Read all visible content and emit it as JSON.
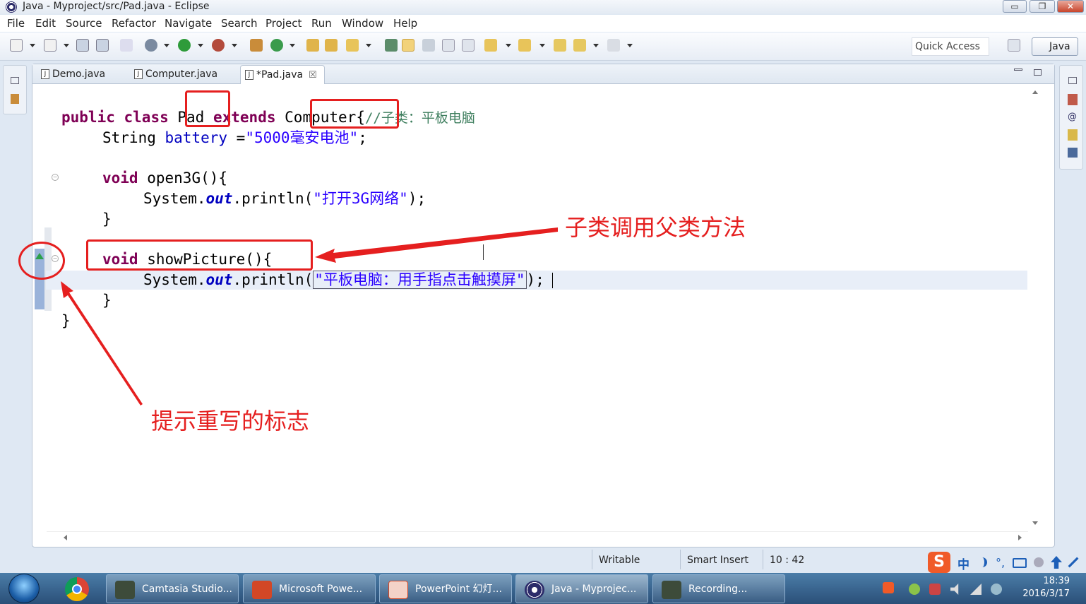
{
  "window": {
    "title": "Java - Myproject/src/Pad.java - Eclipse",
    "buttons": {
      "minimize": "▭",
      "restore": "❐",
      "close": "✕"
    }
  },
  "menu": [
    "File",
    "Edit",
    "Source",
    "Refactor",
    "Navigate",
    "Search",
    "Project",
    "Run",
    "Window",
    "Help"
  ],
  "toolbar": {
    "quick_access": "Quick Access",
    "perspective": "Java"
  },
  "tabs": [
    {
      "label": "Demo.java"
    },
    {
      "label": "Computer.java"
    },
    {
      "label": "*Pad.java",
      "active": true,
      "close": "☒"
    }
  ],
  "code": {
    "line1": {
      "kw1": "public",
      "kw2": "class",
      "name": "Pad",
      "kw3": "extends",
      "parent": "Computer",
      "brace": "{",
      "comment": "//子类：平板电脑"
    },
    "line2": {
      "type": "String",
      "field": "battery",
      "eq": " =",
      "value": "\"5000毫安电池\"",
      "end": ";"
    },
    "line4": {
      "kw": "void",
      "rest": "open3G(){"
    },
    "line5": {
      "a": "System.",
      "b": "out",
      "c": ".println(",
      "str": "\"打开3G网络\"",
      "d": ");"
    },
    "line6": "}",
    "line8": {
      "kw": "void",
      "rest": "showPicture(){"
    },
    "line9": {
      "a": "System.",
      "b": "out",
      "c": ".println(",
      "str": "\"平板电脑：用手指点击触摸屏\"",
      "d": ");"
    },
    "line10": "}",
    "line11": "}"
  },
  "annotations": {
    "arrow_label": "子类调用父类方法",
    "marker_label": "提示重写的标志",
    "accent": "#e51f1f"
  },
  "status": {
    "writable": "Writable",
    "insert_mode": "Smart Insert",
    "position": "10 : 42"
  },
  "taskbar": {
    "items": [
      "Camtasia Studio...",
      "Microsoft Powe...",
      "PowerPoint 幻灯...",
      "Java - Myprojec...",
      "Recording..."
    ],
    "time": "18:39",
    "date": "2016/3/17"
  },
  "ime": {
    "label": "中"
  }
}
